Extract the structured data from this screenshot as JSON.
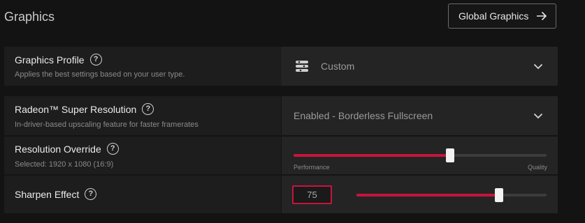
{
  "page": {
    "title": "Graphics"
  },
  "header": {
    "global_graphics_label": "Global Graphics"
  },
  "graphics_profile": {
    "title": "Graphics Profile",
    "description": "Applies the best settings based on your user type.",
    "selected": "Custom"
  },
  "super_resolution": {
    "title": "Radeon™ Super Resolution",
    "description": "In-driver-based upscaling feature for faster framerates",
    "selected": "Enabled - Borderless Fullscreen"
  },
  "resolution_override": {
    "title": "Resolution Override",
    "description": "Selected: 1920 x 1080 (16:9)",
    "slider_fraction": 0.62,
    "min_label": "Performance",
    "max_label": "Quality"
  },
  "sharpen_effect": {
    "title": "Sharpen Effect",
    "value": "75",
    "slider_fraction": 0.75
  },
  "colors": {
    "accent": "#c8143c"
  },
  "icons": {
    "help": "help-circle-icon",
    "chevron": "chevron-down-icon",
    "arrow": "arrow-right-icon",
    "profile": "settings-stack-icon"
  }
}
